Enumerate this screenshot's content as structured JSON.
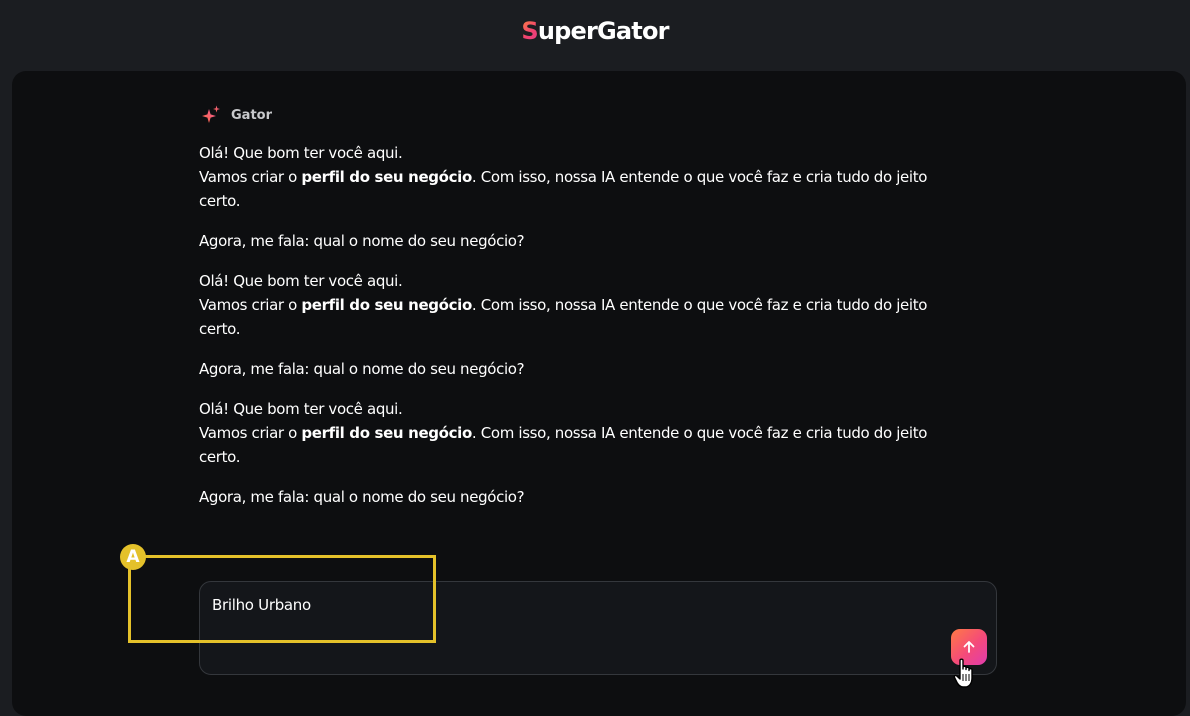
{
  "header": {
    "logo_first_letter": "S",
    "logo_rest": "uperGator"
  },
  "assistant": {
    "name": "Gator",
    "icon": "sparkle-icon"
  },
  "messages": [
    {
      "greeting": "Olá! Que bom ter você aqui.",
      "line_prefix": "Vamos criar o ",
      "line_bold": "perfil do seu negócio",
      "line_suffix": ". Com isso, nossa IA entende o que você faz e cria tudo do jeito certo.",
      "question": "Agora, me fala: qual o nome do seu negócio?"
    },
    {
      "greeting": "Olá! Que bom ter você aqui.",
      "line_prefix": "Vamos criar o ",
      "line_bold": "perfil do seu negócio",
      "line_suffix": ". Com isso, nossa IA entende o que você faz e cria tudo do jeito certo.",
      "question": "Agora, me fala: qual o nome do seu negócio?"
    },
    {
      "greeting": "Olá! Que bom ter você aqui.",
      "line_prefix": "Vamos criar o ",
      "line_bold": "perfil do seu negócio",
      "line_suffix": ". Com isso, nossa IA entende o que você faz e cria tudo do jeito certo.",
      "question": "Agora, me fala: qual o nome do seu negócio?"
    }
  ],
  "input": {
    "value": "Brilho Urbano",
    "send_icon": "arrow-up-icon"
  },
  "annotation": {
    "label": "A",
    "color": "#e4c12a"
  },
  "colors": {
    "background": "#1b1d21",
    "panel": "#0d0e10",
    "accent_start": "#ff7a45",
    "accent_end": "#e13cae"
  }
}
